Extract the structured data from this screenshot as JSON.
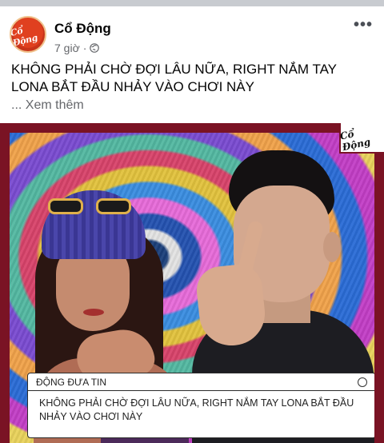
{
  "post": {
    "page_name": "Cổ Động",
    "avatar_text": "Cổ Động",
    "time": "7 giờ",
    "separator": "·",
    "caption": "KHÔNG PHẢI CHỜ ĐỢI LÂU NỮA, RIGHT NẮM TAY LONA BẮT ĐẦU NHẢY VÀO CHƠI NÀY",
    "see_more": "... Xem thêm"
  },
  "media": {
    "stamp_text": "Cổ Động",
    "card_label": "ĐỘNG ĐƯA TIN",
    "card_text": "KHÔNG PHẢI CHỜ ĐỢI LÂU NỮA, RIGHT NẮM TAY LONA BẮT ĐẦU NHẢY VÀO CHƠI NÀY"
  },
  "icons": {
    "globe": "globe-icon",
    "more": "more-options-icon",
    "card_circle": "circle-icon"
  },
  "colors": {
    "frame": "#7a1324",
    "page_name": "#050505",
    "meta": "#65676b"
  }
}
